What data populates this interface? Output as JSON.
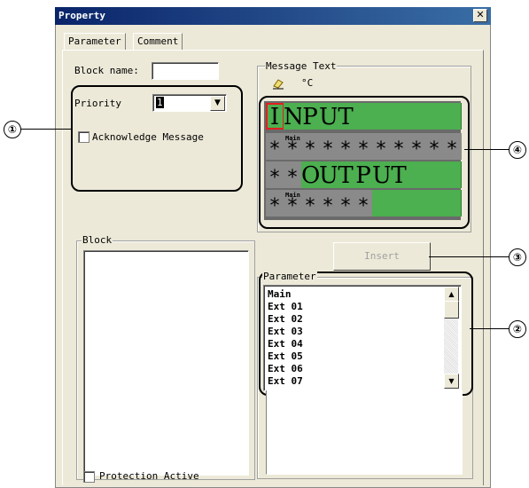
{
  "window": {
    "title": "Property",
    "close_label": "✕"
  },
  "tabs": [
    {
      "label": "Parameter"
    },
    {
      "label": "Comment"
    }
  ],
  "block_name": {
    "label": "Block name:",
    "value": ""
  },
  "priority": {
    "label": "Priority",
    "value": "1"
  },
  "acknowledge": {
    "label": "Acknowledge Message",
    "checked": false
  },
  "message_text": {
    "label": "Message Text",
    "unit_label": "°C"
  },
  "lcd": {
    "row1": [
      "I",
      "N",
      "P",
      "U",
      "T",
      "",
      "",
      "",
      "",
      "",
      ""
    ],
    "row2_label": "Main",
    "row2": [
      "*",
      "*",
      "*",
      "*",
      "*",
      "*",
      "*",
      "*",
      "*",
      "*",
      "*"
    ],
    "row3": [
      "*",
      "*",
      "O",
      "U",
      "T",
      "P",
      "U",
      "T",
      "",
      "",
      ""
    ],
    "row4_label": "Main",
    "row4": [
      "*",
      "*",
      "*",
      "*",
      "*",
      "*",
      "",
      "",
      "",
      "",
      ""
    ]
  },
  "block": {
    "label": "Block"
  },
  "insert_button": {
    "label": "Insert"
  },
  "parameter": {
    "label": "Parameter",
    "items": [
      "Main",
      "Ext 01",
      "Ext 02",
      "Ext 03",
      "Ext 04",
      "Ext 05",
      "Ext 06",
      "Ext 07"
    ]
  },
  "protection": {
    "label": "Protection Active",
    "checked": false
  },
  "callouts": [
    "①",
    "②",
    "③",
    "④"
  ],
  "colors": {
    "lcd_green": "#4caf50",
    "lcd_grey": "#8a8a8a",
    "cursor": "#e02020",
    "titlebar": "#0a246a"
  }
}
